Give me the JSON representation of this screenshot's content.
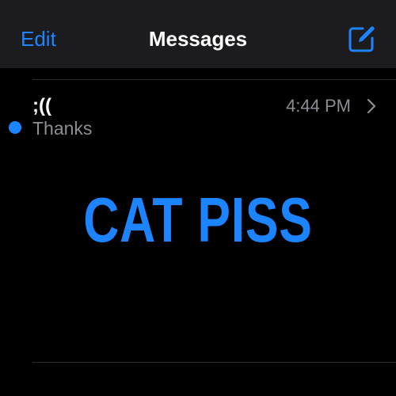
{
  "nav": {
    "edit_label": "Edit",
    "title": "Messages",
    "compose_icon": "compose-square-pencil-icon"
  },
  "conversations": [
    {
      "name": ";((",
      "time": "4:44 PM",
      "preview": "Thanks",
      "unread": true
    }
  ],
  "overlay": {
    "caption": "CAT PISS"
  },
  "colors": {
    "accent": "#1c84ff",
    "background": "#000000",
    "nav_background": "#1c1c1e",
    "secondary_text": "#8d8d93",
    "separator": "#2c2c2e"
  }
}
